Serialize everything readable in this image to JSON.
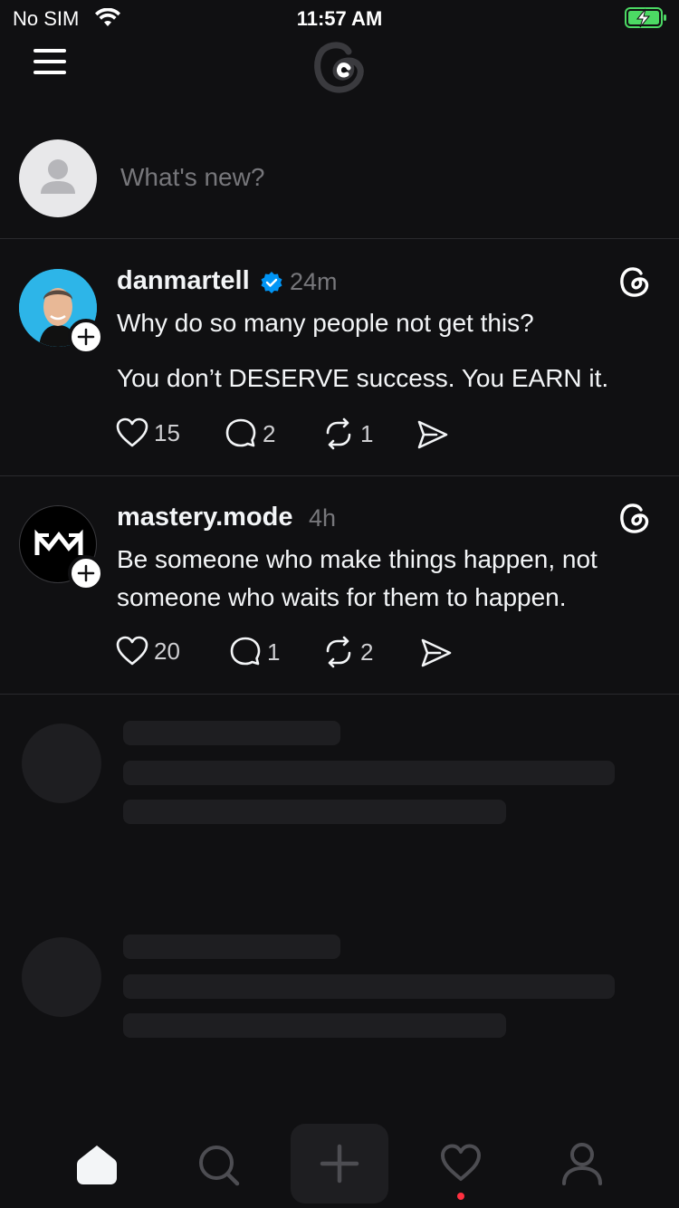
{
  "status": {
    "carrier": "No SIM",
    "time": "11:57 AM"
  },
  "composer": {
    "placeholder": "What's new?"
  },
  "posts": [
    {
      "username": "danmartell",
      "verified": true,
      "time": "24m",
      "text_lines": [
        "Why do so many people not get this?",
        "You don’t DESERVE success. You EARN it."
      ],
      "likes": "15",
      "replies": "2",
      "reposts": "1"
    },
    {
      "username": "mastery.mode",
      "verified": false,
      "time": "4h",
      "text_lines": [
        "Be someone who make things happen, not someone who waits for them to happen."
      ],
      "likes": "20",
      "replies": "1",
      "reposts": "2"
    }
  ],
  "tabs": [
    "home-icon",
    "search-icon",
    "compose-icon",
    "activity-icon",
    "profile-icon"
  ],
  "colors": {
    "background": "#101012",
    "verified": "#0095f6",
    "notification": "#ff3040",
    "battery": "#4cd964"
  }
}
